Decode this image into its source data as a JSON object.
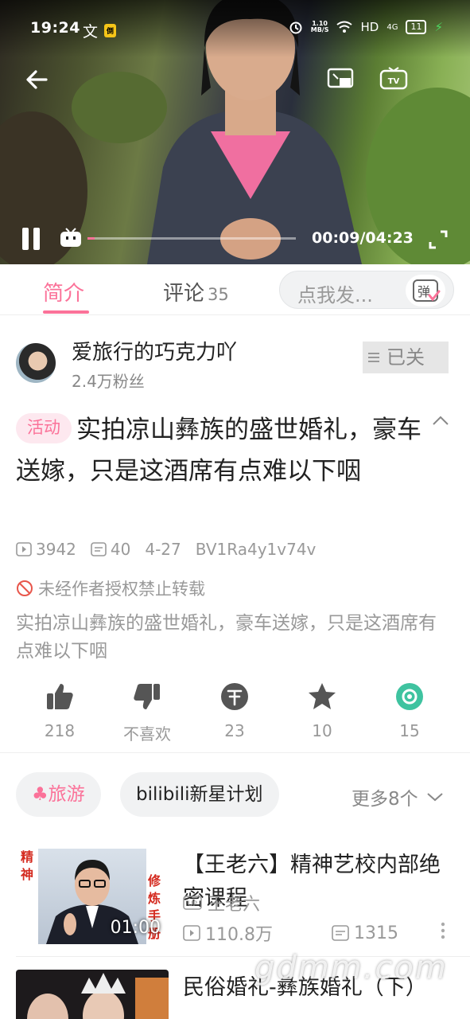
{
  "status_bar": {
    "time": "19:24",
    "network_speed": "1.10\nMB/S",
    "signal_label": "HD",
    "network_type": "4G",
    "battery": "11",
    "chip": "倒"
  },
  "player": {
    "time_display": "00:09/04:23",
    "progress": 0.034
  },
  "tabs": {
    "intro": "简介",
    "comments": "评论",
    "comments_count": "35",
    "danmaku_placeholder": "点我发...",
    "danmaku_icon_label": "弹"
  },
  "uploader": {
    "name": "爱旅行的巧克力吖",
    "fans": "2.4万粉丝",
    "follow_label": "已关"
  },
  "video": {
    "tag": "活动",
    "title": "实拍凉山彝族的盛世婚礼，豪车送嫁，只是这酒席有点难以下咽",
    "plays": "3942",
    "danmaku": "40",
    "date": "4-27",
    "bvid": "BV1Ra4y1v74v",
    "copyright": "未经作者授权禁止转载",
    "description": "实拍凉山彝族的盛世婚礼，豪车送嫁，只是这酒席有点难以下咽"
  },
  "actions": {
    "like": "218",
    "dislike": "不喜欢",
    "coin": "23",
    "favorite": "10",
    "share": "15"
  },
  "tags": {
    "travel": "旅游",
    "bili": "bilibili新星计划",
    "more": "更多8个"
  },
  "recommendations": [
    {
      "title": "【王老六】精神艺校内部绝密课程",
      "uploader": "王老六",
      "duration": "01:00",
      "plays": "110.8万",
      "danmaku": "1315",
      "thumb_text_left": "精神",
      "thumb_text_right": "修炼手册"
    },
    {
      "title": "民俗婚礼-彝族婚礼（下）",
      "uploader": "",
      "duration": "",
      "plays": "",
      "danmaku": ""
    }
  ],
  "watermark": "gdmm.com"
}
